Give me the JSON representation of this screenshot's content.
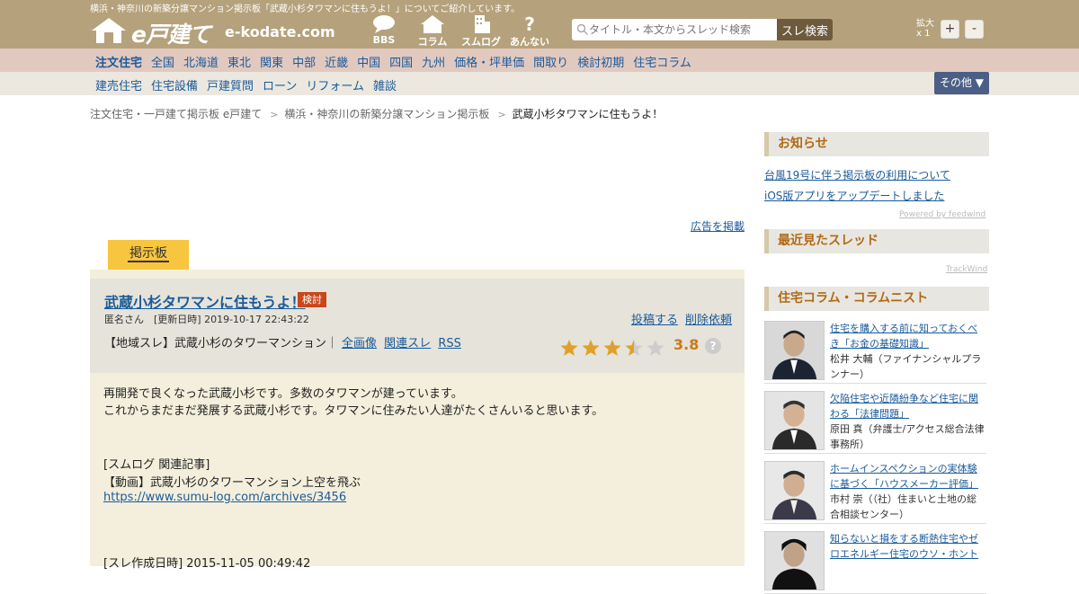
{
  "header": {
    "tagline": "横浜・神奈川の新築分譲マンション掲示板「武蔵小杉タワマンに住もうよ！」についてご紹介しています。",
    "logo_text": "e戸建て",
    "logo_url": "e-kodate.com",
    "nav_icons": [
      {
        "label": "BBS",
        "icon": "speech-bubble-icon"
      },
      {
        "label": "コラム",
        "icon": "house-icon"
      },
      {
        "label": "スムログ",
        "icon": "building-icon"
      },
      {
        "label": "あんない",
        "icon": "question-icon"
      }
    ],
    "search_placeholder": "タイトル・本文からスレッド検索",
    "search_button": "スレ検索",
    "zoom_label_1": "拡大",
    "zoom_label_2": "x 1",
    "zoom_in": "+",
    "zoom_out": "-"
  },
  "nav_primary": [
    "注文住宅",
    "全国",
    "北海道",
    "東北",
    "関東",
    "中部",
    "近畿",
    "中国",
    "四国",
    "九州",
    "価格・坪単価",
    "間取り",
    "検討初期",
    "住宅コラム"
  ],
  "nav_secondary": [
    "建売住宅",
    "住宅設備",
    "戸建質問",
    "ローン",
    "リフォーム",
    "雑談"
  ],
  "other_button": "その他 ▼",
  "breadcrumb": [
    "注文住宅・一戸建て掲示板 e戸建て",
    "横浜・神奈川の新築分譲マンション掲示板",
    "武蔵小杉タワマンに住もうよ！"
  ],
  "breadcrumb_sep": ">",
  "ad_link": "広告を掲載",
  "tab_label": "掲示板",
  "post": {
    "title": "武蔵小杉タワマンに住もうよ！",
    "badge": "検討",
    "meta": "匿名さん　[更新日時] 2019-10-17 22:43:22",
    "action_post": "投稿する",
    "action_delete": "削除依頼",
    "tag_text": "【地域スレ】武蔵小杉のタワーマンション｜",
    "links": [
      "全画像",
      "関連スレ",
      "RSS"
    ],
    "rating": 3.8,
    "rating_text": "3.8",
    "help": "?",
    "body": [
      "再開発で良くなった武蔵小杉です。多数のタワマンが建っています。",
      "これからまだまだ発展する武蔵小杉です。タワマンに住みたい人達がたくさんいると思います。",
      "[スムログ 関連記事]",
      "【動画】武蔵小杉のタワーマンション上空を飛ぶ",
      "https://www.sumu-log.com/archives/3456",
      "[スレ作成日時] 2015-11-05 00:49:42"
    ]
  },
  "sidebar": {
    "news_title": "お知らせ",
    "news": [
      "台風19号に伴う掲示板の利用について",
      "iOS版アプリをアップデートしました"
    ],
    "powered": "Powered by feedwind",
    "recent_title": "最近見たスレッド",
    "trackwind": "TrackWind",
    "column_title": "住宅コラム・コラムニスト",
    "columns": [
      {
        "title": "住宅を購入する前に知っておくべき「お金の基礎知識」",
        "author": "松井 大輔（ファイナンシャルプランナー）"
      },
      {
        "title": "欠陥住宅や近隣紛争など住宅に関わる「法律問題」",
        "author": "原田 真（弁護士/アクセス総合法律事務所）"
      },
      {
        "title": "ホームインスペクションの実体験に基づく「ハウスメーカー評価」",
        "author": "市村 崇（（社）住まいと土地の総合相談センター）"
      },
      {
        "title": "知らないと損をする断熱住宅やゼロエネルギー住宅のウソ・ホント",
        "author": ""
      }
    ]
  },
  "colors": {
    "header_bg": "#b5a27c",
    "nav1_bg": "#e2c9c0",
    "nav2_bg": "#ece8df",
    "accent": "#b06a14",
    "link": "#1a5a9a",
    "tab": "#f8c53f"
  }
}
